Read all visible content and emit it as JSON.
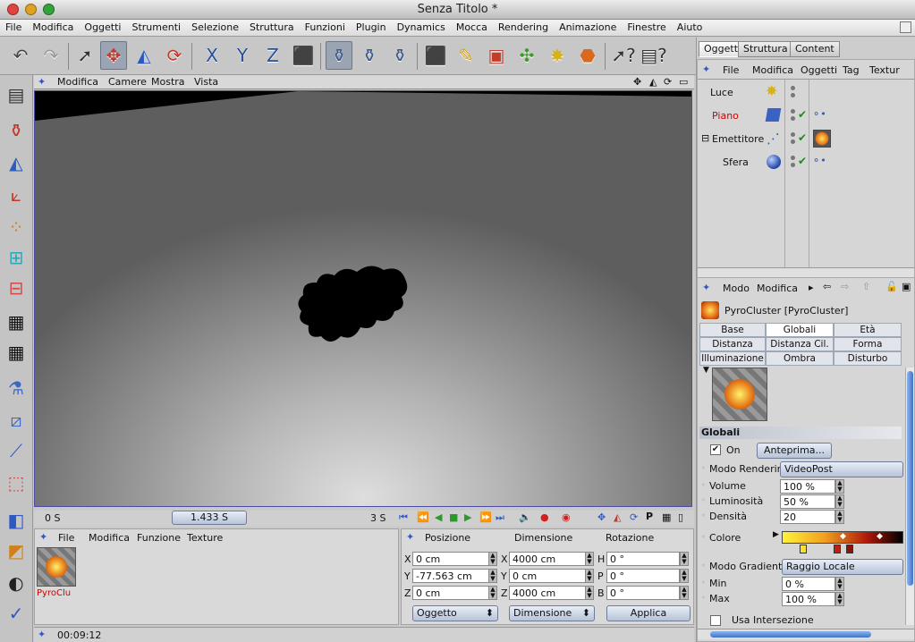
{
  "window": {
    "title": "Senza Titolo *"
  },
  "menubar": [
    "File",
    "Modifica",
    "Oggetti",
    "Strumenti",
    "Selezione",
    "Struttura",
    "Funzioni",
    "Plugin",
    "Dynamics",
    "Mocca",
    "Rendering",
    "Animazione",
    "Finestre",
    "Aiuto"
  ],
  "viewport": {
    "menu": [
      "Modifica",
      "Camere",
      "Mostra",
      "Vista"
    ]
  },
  "timeline": {
    "start": "0 S",
    "current": "1.433 S",
    "end": "3 S"
  },
  "materials": {
    "menu": [
      "File",
      "Modifica",
      "Funzione",
      "Texture"
    ],
    "item_label": "PyroClu"
  },
  "coords": {
    "headers": [
      "Posizione",
      "Dimensione",
      "Rotazione"
    ],
    "pos_labels": [
      "X",
      "Y",
      "Z"
    ],
    "pos": [
      "0 cm",
      "-77.563 cm",
      "0 cm"
    ],
    "dim_labels": [
      "X",
      "Y",
      "Z"
    ],
    "dim": [
      "4000 cm",
      "0 cm",
      "4000 cm"
    ],
    "rot_labels": [
      "H",
      "P",
      "B"
    ],
    "rot": [
      "0 °",
      "0 °",
      "0 °"
    ],
    "mode": "Oggetto",
    "size_mode": "Dimensione",
    "apply": "Applica"
  },
  "status": {
    "time": "00:09:12"
  },
  "objects": {
    "tabs": [
      "Oggetti",
      "Struttura",
      "Content"
    ],
    "menu": [
      "File",
      "Modifica",
      "Oggetti",
      "Tag",
      "Textur"
    ],
    "items": [
      {
        "name": "Luce",
        "color": "#111111"
      },
      {
        "name": "Piano",
        "color": "#d40000"
      },
      {
        "name": "Emettitore",
        "color": "#111111"
      },
      {
        "name": "Sfera",
        "color": "#111111"
      }
    ]
  },
  "attributes": {
    "menu": [
      "Modo",
      "Modifica"
    ],
    "object_title": "PyroCluster [PyroCluster]",
    "tabs": [
      "Base",
      "Globali",
      "Età",
      "Distanza",
      "Distanza Cil.",
      "Forma",
      "Illuminazione",
      "Ombra",
      "Disturbo"
    ],
    "section": "Globali",
    "on_label": "On",
    "preview_button": "Anteprima...",
    "render_mode_label": "Modo Rendering",
    "render_mode_value": "VideoPost",
    "volume_label": "Volume",
    "volume_value": "100 %",
    "luminosity_label": "Luminosità",
    "luminosity_value": "50 %",
    "density_label": "Densità",
    "density_value": "20",
    "color_label": "Colore",
    "gradient_mode_label": "Modo Gradiente",
    "gradient_mode_value": "Raggio Locale",
    "min_label": "Min",
    "min_value": "0 %",
    "max_label": "Max",
    "max_value": "100 %",
    "use_intersection": "Usa Intersezione"
  }
}
